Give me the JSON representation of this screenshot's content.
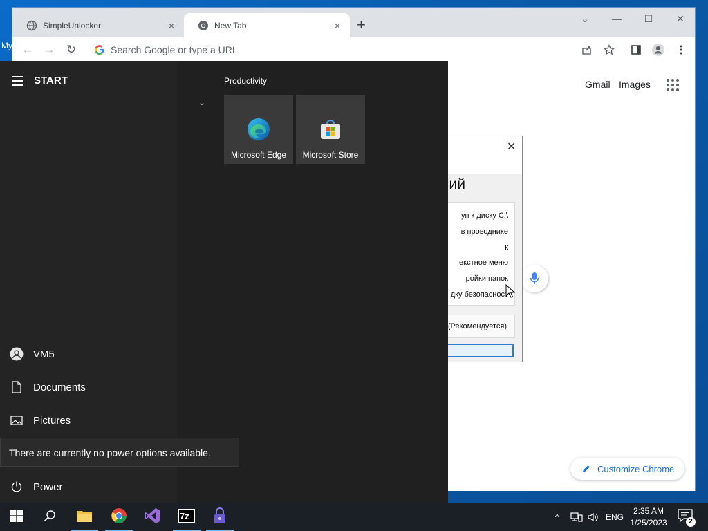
{
  "desktop": {
    "label_fragment": "My"
  },
  "browser": {
    "tabs": [
      {
        "label": "SimpleUnlocker",
        "close": "×"
      },
      {
        "label": "New Tab",
        "close": "×"
      }
    ],
    "new_tab": "+",
    "window_controls": {
      "dropdown": "⌄",
      "minimize": "—",
      "maximize": "☐",
      "close": "✕"
    },
    "toolbar": {
      "back": "←",
      "forward": "→",
      "reload": "↻",
      "omnibox_placeholder": "Search Google or type a URL"
    },
    "page": {
      "links": [
        "Gmail",
        "Images"
      ],
      "customize_label": "Customize Chrome"
    }
  },
  "dialog": {
    "close": "✕",
    "heading_fragment": "ий",
    "list_items": [
      "уп к диску C:\\",
      "в проводнике",
      "к",
      "екстное меню",
      "ройки папок",
      "дку безопасност"
    ],
    "recommended_fragment": "(Рекомендуется)"
  },
  "start_menu": {
    "title": "START",
    "user": "VM5",
    "documents": "Documents",
    "pictures": "Pictures",
    "power": "Power",
    "power_tooltip": "There are currently no power options available.",
    "group_label": "Productivity",
    "collapse": "⌄",
    "tiles": [
      {
        "label": "Microsoft Edge",
        "icon": "edge-icon"
      },
      {
        "label": "Microsoft Store",
        "icon": "store-icon"
      }
    ]
  },
  "taskbar": {
    "apps": [
      "start-icon",
      "search-icon",
      "file-explorer-icon",
      "chrome-icon",
      "visual-studio-icon",
      "7zip-icon",
      "simpleunlocker-icon"
    ],
    "tray": {
      "chevron": "^",
      "language": "ENG"
    },
    "clock": {
      "time": "2:35 AM",
      "date": "1/25/2023"
    },
    "notifications": {
      "count": "2"
    }
  }
}
